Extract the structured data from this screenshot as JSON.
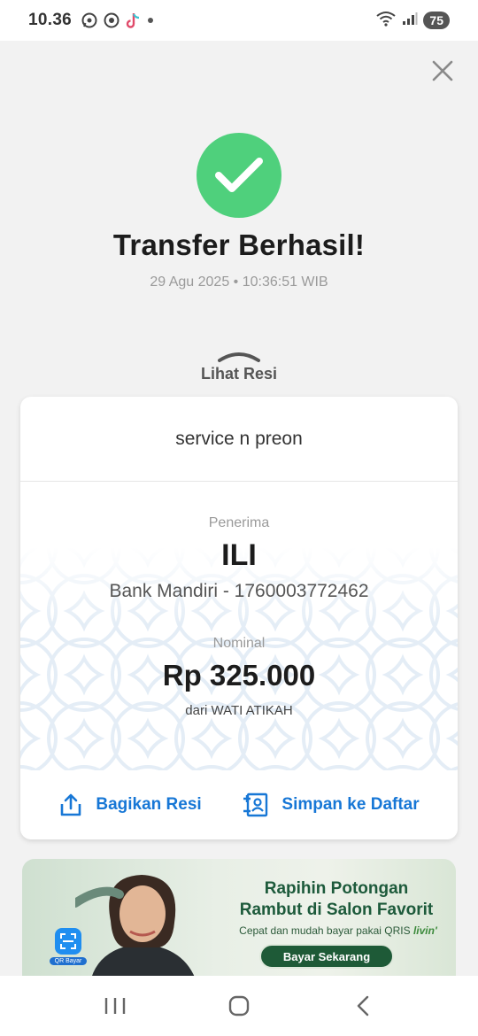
{
  "status_bar": {
    "time": "10.36",
    "battery": "75",
    "icons_left": [
      "whatsapp-icon",
      "chrome-icon",
      "tiktok-icon",
      "dot-icon"
    ],
    "icons_right": [
      "wifi-icon",
      "signal-icon",
      "battery-icon"
    ]
  },
  "header": {
    "close_icon": "close-icon"
  },
  "success": {
    "title": "Transfer Berhasil!",
    "datetime": "29 Agu 2025 • 10:36:51 WIB",
    "icon": "check-icon",
    "color": "#4fd07c"
  },
  "receipt_toggle": {
    "label": "Lihat Resi",
    "icon": "chevron-up-icon"
  },
  "receipt": {
    "note": "service n preon",
    "recipient_label": "Penerima",
    "recipient_name": "ILI",
    "recipient_bank": "Bank Mandiri - 1760003772462",
    "amount_label": "Nominal",
    "amount": "Rp 325.000",
    "sender": "dari WATI ATIKAH"
  },
  "actions": {
    "share_label": "Bagikan Resi",
    "share_icon": "share-icon",
    "save_label": "Simpan ke Daftar",
    "save_icon": "add-contact-icon",
    "accent": "#1777d6"
  },
  "promo": {
    "title_line1": "Rapihin Potongan",
    "title_line2": "Rambut di Salon Favorit",
    "subtitle": "Cepat dan mudah bayar pakai QRIS",
    "brand": "livin'",
    "button": "Bayar Sekarang",
    "qr_label": "QR Bayar"
  },
  "nav": {
    "recent_icon": "recent-apps-icon",
    "home_icon": "home-icon",
    "back_icon": "back-icon"
  }
}
